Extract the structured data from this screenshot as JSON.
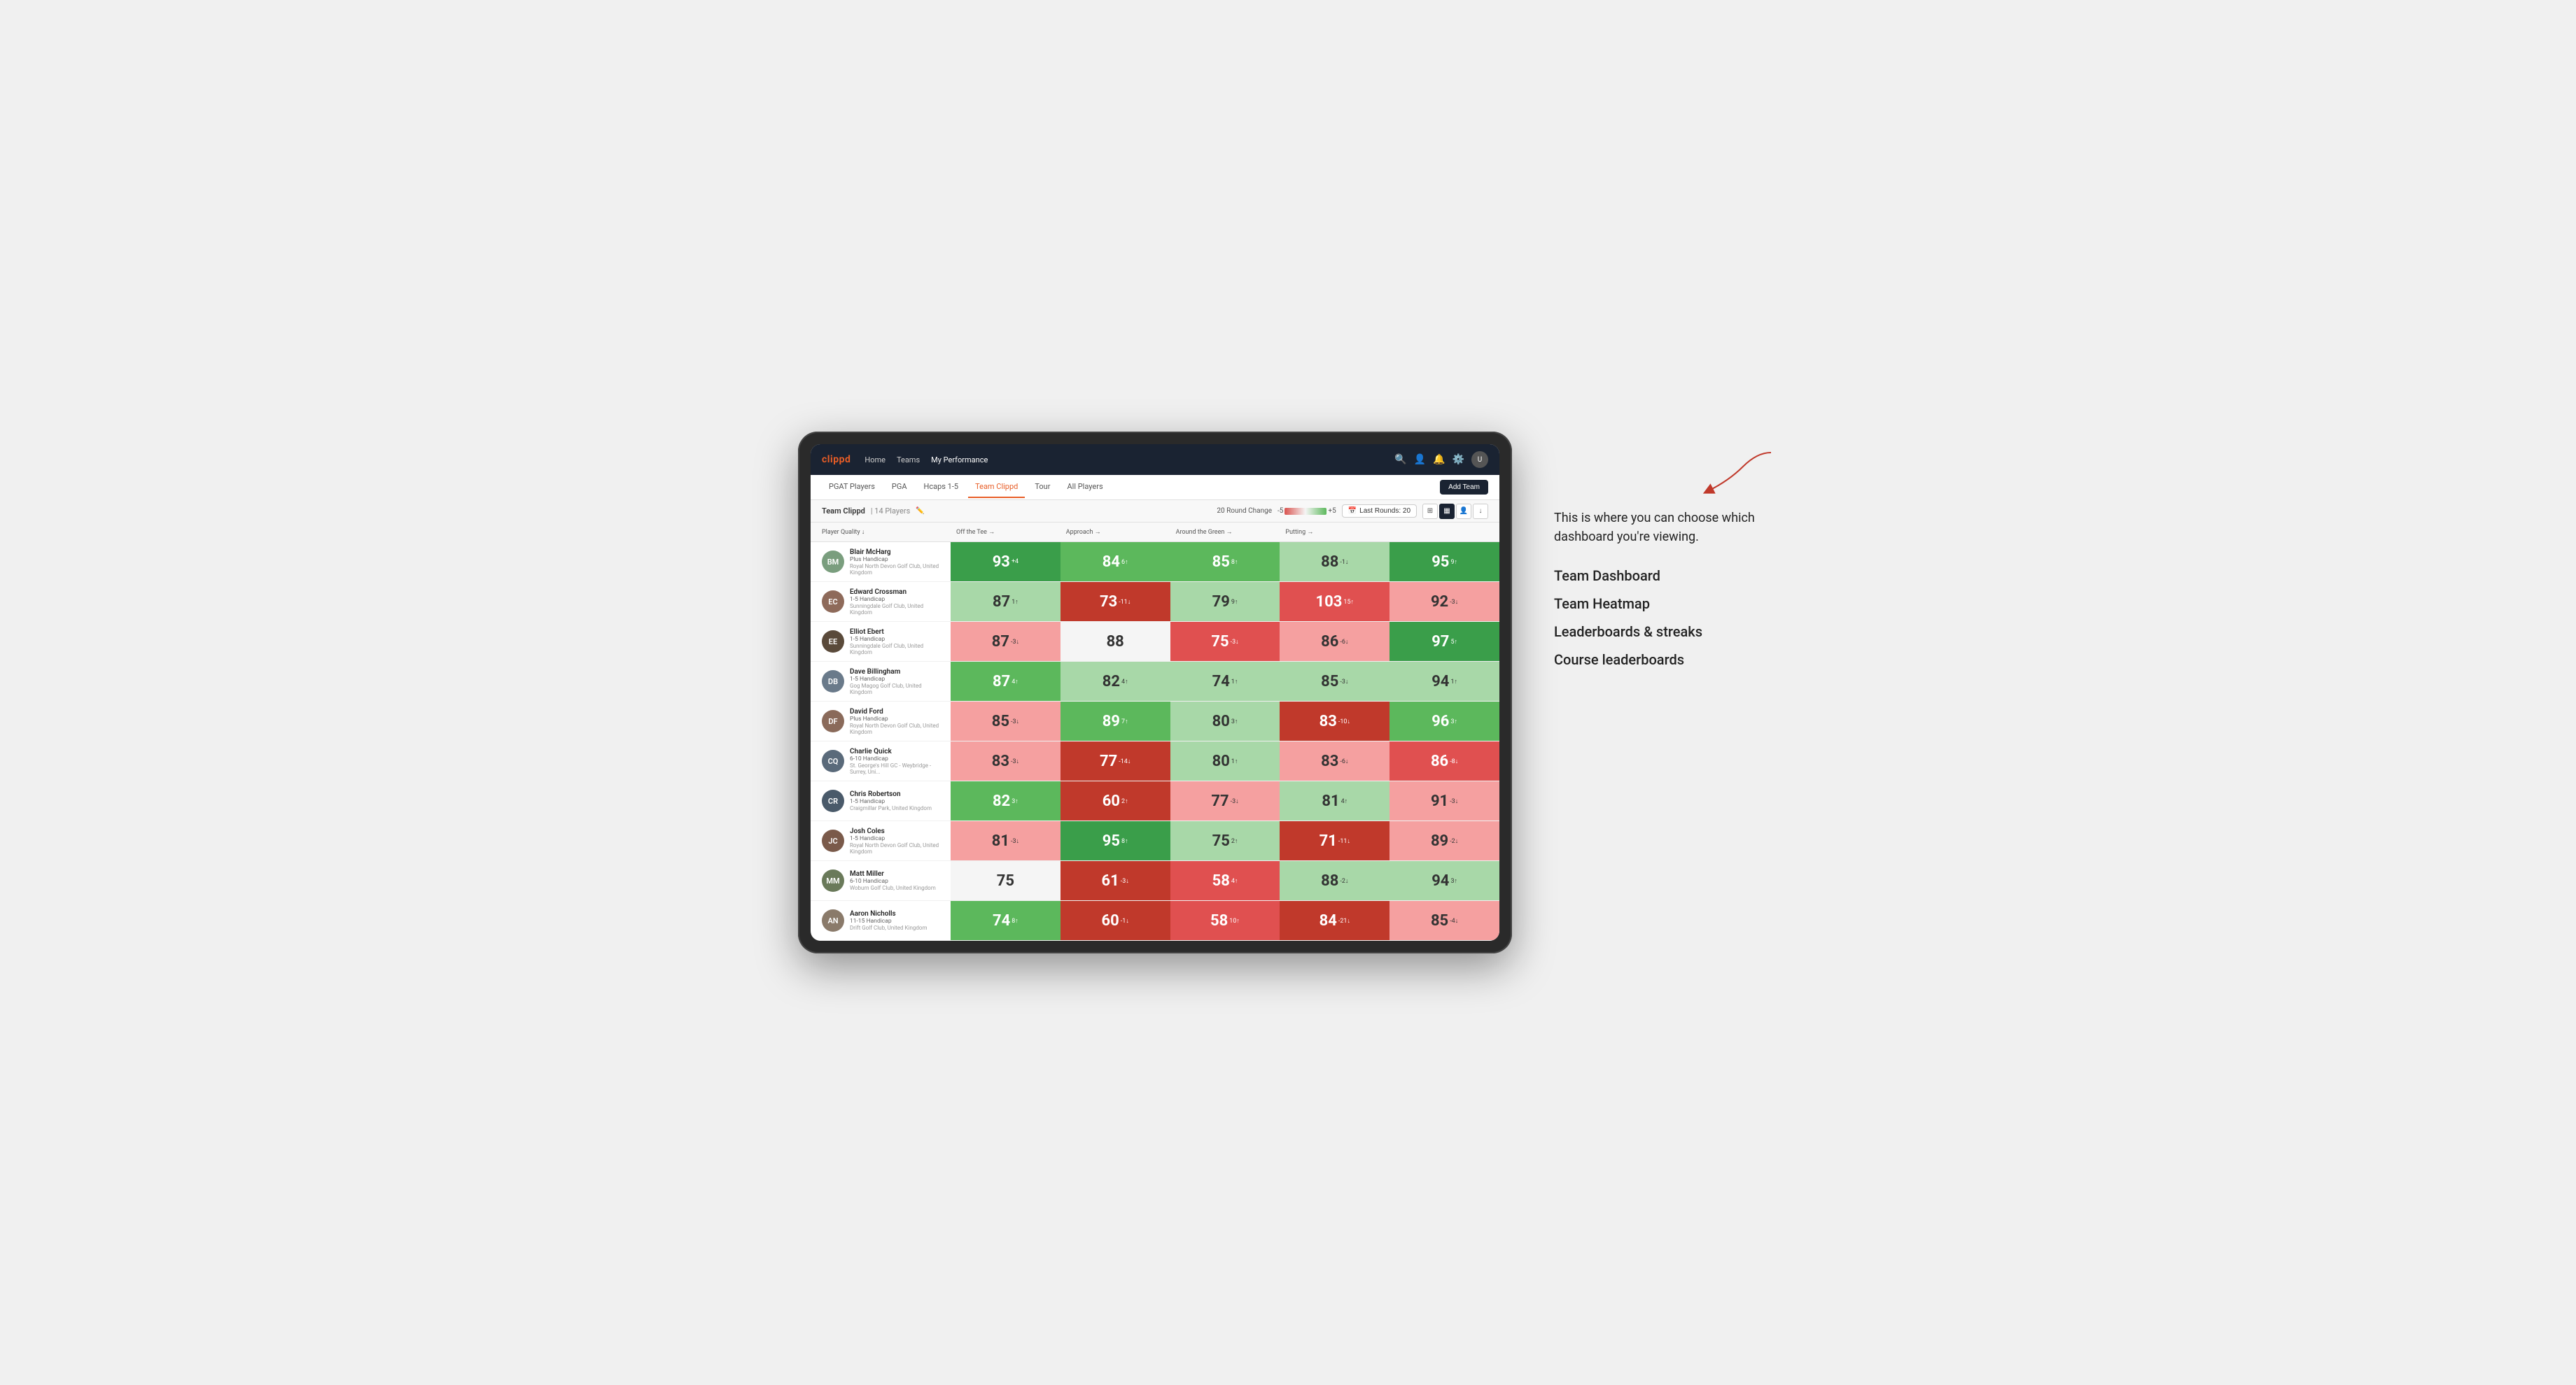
{
  "annotation": {
    "intro_text": "This is where you can choose which dashboard you're viewing.",
    "options": [
      "Team Dashboard",
      "Team Heatmap",
      "Leaderboards & streaks",
      "Course leaderboards"
    ]
  },
  "nav": {
    "logo": "clippd",
    "links": [
      "Home",
      "Teams",
      "My Performance"
    ],
    "active_link": "My Performance"
  },
  "sub_nav": {
    "tabs": [
      "PGAT Players",
      "PGA",
      "Hcaps 1-5",
      "Team Clippd",
      "Tour",
      "All Players"
    ],
    "active_tab": "Team Clippd",
    "add_team_label": "Add Team"
  },
  "team_bar": {
    "title": "Team Clippd",
    "separator": "|",
    "count": "14 Players",
    "round_change_label": "20 Round Change",
    "legend_min": "-5",
    "legend_max": "+5",
    "last_rounds_label": "Last Rounds: 20"
  },
  "table": {
    "columns": [
      "Player Quality ↓",
      "Off the Tee →",
      "Approach →",
      "Around the Green →",
      "Putting →"
    ],
    "rows": [
      {
        "name": "Blair McHarg",
        "handicap": "Plus Handicap",
        "club": "Royal North Devon Golf Club, United Kingdom",
        "avatar_initials": "BM",
        "avatar_color": "#7a9e7e",
        "scores": [
          {
            "value": 93,
            "change": "+4",
            "direction": "up",
            "bg": "green-strong"
          },
          {
            "value": 84,
            "change": "6↑",
            "direction": "up",
            "bg": "green-medium"
          },
          {
            "value": 85,
            "change": "8↑",
            "direction": "up",
            "bg": "green-medium"
          },
          {
            "value": 88,
            "change": "-1↓",
            "direction": "down",
            "bg": "green-light"
          },
          {
            "value": 95,
            "change": "9↑",
            "direction": "up",
            "bg": "green-strong"
          }
        ]
      },
      {
        "name": "Edward Crossman",
        "handicap": "1-5 Handicap",
        "club": "Sunningdale Golf Club, United Kingdom",
        "avatar_initials": "EC",
        "avatar_color": "#8e6a5a",
        "scores": [
          {
            "value": 87,
            "change": "1↑",
            "direction": "up",
            "bg": "green-light"
          },
          {
            "value": 73,
            "change": "-11↓",
            "direction": "down",
            "bg": "red-strong"
          },
          {
            "value": 79,
            "change": "9↑",
            "direction": "up",
            "bg": "green-light"
          },
          {
            "value": 103,
            "change": "15↑",
            "direction": "up",
            "bg": "red-medium"
          },
          {
            "value": 92,
            "change": "-3↓",
            "direction": "down",
            "bg": "red-light"
          }
        ]
      },
      {
        "name": "Elliot Ebert",
        "handicap": "1-5 Handicap",
        "club": "Sunningdale Golf Club, United Kingdom",
        "avatar_initials": "EE",
        "avatar_color": "#5a4a3a",
        "scores": [
          {
            "value": 87,
            "change": "-3↓",
            "direction": "down",
            "bg": "red-light"
          },
          {
            "value": 88,
            "change": "",
            "direction": "neutral",
            "bg": "neutral"
          },
          {
            "value": 75,
            "change": "-3↓",
            "direction": "down",
            "bg": "red-medium"
          },
          {
            "value": 86,
            "change": "-6↓",
            "direction": "down",
            "bg": "red-light"
          },
          {
            "value": 97,
            "change": "5↑",
            "direction": "up",
            "bg": "green-strong"
          }
        ]
      },
      {
        "name": "Dave Billingham",
        "handicap": "1-5 Handicap",
        "club": "Gog Magog Golf Club, United Kingdom",
        "avatar_initials": "DB",
        "avatar_color": "#6a7a8a",
        "scores": [
          {
            "value": 87,
            "change": "4↑",
            "direction": "up",
            "bg": "green-medium"
          },
          {
            "value": 82,
            "change": "4↑",
            "direction": "up",
            "bg": "green-light"
          },
          {
            "value": 74,
            "change": "1↑",
            "direction": "up",
            "bg": "green-light"
          },
          {
            "value": 85,
            "change": "-3↓",
            "direction": "down",
            "bg": "green-light"
          },
          {
            "value": 94,
            "change": "1↑",
            "direction": "up",
            "bg": "green-light"
          }
        ]
      },
      {
        "name": "David Ford",
        "handicap": "Plus Handicap",
        "club": "Royal North Devon Golf Club, United Kingdom",
        "avatar_initials": "DF",
        "avatar_color": "#8a6a5a",
        "scores": [
          {
            "value": 85,
            "change": "-3↓",
            "direction": "down",
            "bg": "red-light"
          },
          {
            "value": 89,
            "change": "7↑",
            "direction": "up",
            "bg": "green-medium"
          },
          {
            "value": 80,
            "change": "3↑",
            "direction": "up",
            "bg": "green-light"
          },
          {
            "value": 83,
            "change": "-10↓",
            "direction": "down",
            "bg": "red-strong"
          },
          {
            "value": 96,
            "change": "3↑",
            "direction": "up",
            "bg": "green-medium"
          }
        ]
      },
      {
        "name": "Charlie Quick",
        "handicap": "6-10 Handicap",
        "club": "St. George's Hill GC - Weybridge - Surrey, Uni...",
        "avatar_initials": "CQ",
        "avatar_color": "#5a6a7a",
        "scores": [
          {
            "value": 83,
            "change": "-3↓",
            "direction": "down",
            "bg": "red-light"
          },
          {
            "value": 77,
            "change": "-14↓",
            "direction": "down",
            "bg": "red-strong"
          },
          {
            "value": 80,
            "change": "1↑",
            "direction": "up",
            "bg": "green-light"
          },
          {
            "value": 83,
            "change": "-6↓",
            "direction": "down",
            "bg": "red-light"
          },
          {
            "value": 86,
            "change": "-8↓",
            "direction": "down",
            "bg": "red-medium"
          }
        ]
      },
      {
        "name": "Chris Robertson",
        "handicap": "1-5 Handicap",
        "club": "Craigmillar Park, United Kingdom",
        "avatar_initials": "CR",
        "avatar_color": "#4a5a6a",
        "scores": [
          {
            "value": 82,
            "change": "3↑",
            "direction": "up",
            "bg": "green-medium"
          },
          {
            "value": 60,
            "change": "2↑",
            "direction": "up",
            "bg": "red-strong"
          },
          {
            "value": 77,
            "change": "-3↓",
            "direction": "down",
            "bg": "red-light"
          },
          {
            "value": 81,
            "change": "4↑",
            "direction": "up",
            "bg": "green-light"
          },
          {
            "value": 91,
            "change": "-3↓",
            "direction": "down",
            "bg": "red-light"
          }
        ]
      },
      {
        "name": "Josh Coles",
        "handicap": "1-5 Handicap",
        "club": "Royal North Devon Golf Club, United Kingdom",
        "avatar_initials": "JC",
        "avatar_color": "#7a5a4a",
        "scores": [
          {
            "value": 81,
            "change": "-3↓",
            "direction": "down",
            "bg": "red-light"
          },
          {
            "value": 95,
            "change": "8↑",
            "direction": "up",
            "bg": "green-strong"
          },
          {
            "value": 75,
            "change": "2↑",
            "direction": "up",
            "bg": "green-light"
          },
          {
            "value": 71,
            "change": "-11↓",
            "direction": "down",
            "bg": "red-strong"
          },
          {
            "value": 89,
            "change": "-2↓",
            "direction": "down",
            "bg": "red-light"
          }
        ]
      },
      {
        "name": "Matt Miller",
        "handicap": "6-10 Handicap",
        "club": "Woburn Golf Club, United Kingdom",
        "avatar_initials": "MM",
        "avatar_color": "#6a7a5a",
        "scores": [
          {
            "value": 75,
            "change": "",
            "direction": "neutral",
            "bg": "neutral"
          },
          {
            "value": 61,
            "change": "-3↓",
            "direction": "down",
            "bg": "red-strong"
          },
          {
            "value": 58,
            "change": "4↑",
            "direction": "up",
            "bg": "red-medium"
          },
          {
            "value": 88,
            "change": "-2↓",
            "direction": "down",
            "bg": "green-light"
          },
          {
            "value": 94,
            "change": "3↑",
            "direction": "up",
            "bg": "green-light"
          }
        ]
      },
      {
        "name": "Aaron Nicholls",
        "handicap": "11-15 Handicap",
        "club": "Drift Golf Club, United Kingdom",
        "avatar_initials": "AN",
        "avatar_color": "#8a7a6a",
        "scores": [
          {
            "value": 74,
            "change": "8↑",
            "direction": "up",
            "bg": "green-medium"
          },
          {
            "value": 60,
            "change": "-1↓",
            "direction": "down",
            "bg": "red-strong"
          },
          {
            "value": 58,
            "change": "10↑",
            "direction": "up",
            "bg": "red-medium"
          },
          {
            "value": 84,
            "change": "-21↓",
            "direction": "down",
            "bg": "red-strong"
          },
          {
            "value": 85,
            "change": "-4↓",
            "direction": "down",
            "bg": "red-light"
          }
        ]
      }
    ]
  }
}
